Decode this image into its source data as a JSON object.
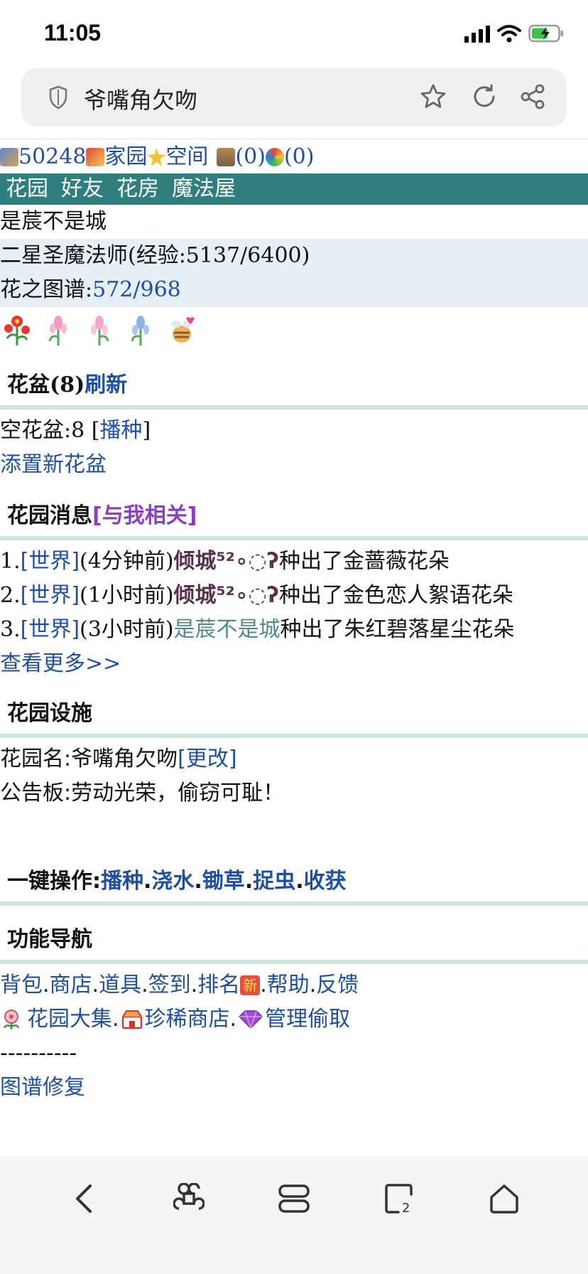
{
  "status_bar": {
    "time": "11:05"
  },
  "url_bar": {
    "title": "爷嘴角欠吻"
  },
  "top_line": {
    "coins": "50248",
    "home": "家园",
    "space": "空间",
    "count1": "(0)",
    "count2": "(0)"
  },
  "nav": {
    "items": [
      "花园",
      "好友",
      "花房",
      "魔法屋"
    ]
  },
  "profile": {
    "name": "是莀不是城",
    "rank_text": "二星圣魔法师(经验:5137/6400)",
    "atlas_label": "花之图谱:",
    "atlas_value": "572/968"
  },
  "pots": {
    "title": "花盆(8)",
    "refresh": "刷新",
    "empty_label": "空花盆:8 [",
    "sow": "播种",
    "empty_close": "]",
    "add": "添置新花盆"
  },
  "messages": {
    "title": "花园消息",
    "filter": "[与我相关]",
    "items": [
      {
        "num": "1.",
        "tag": "[世界]",
        "time": "(4分钟前)",
        "user": "倾城⁵²∘◌ʔ",
        "text": " 种出了金蔷薇花朵"
      },
      {
        "num": "2.",
        "tag": "[世界]",
        "time": "(1小时前)",
        "user": "倾城⁵²∘◌ʔ",
        "text": " 种出了金色恋人絮语花朵"
      },
      {
        "num": "3.",
        "tag": "[世界]",
        "time": "(3小时前)",
        "user": "是莀不是城",
        "text": "种出了朱红碧落星尘花朵"
      }
    ],
    "more": "查看更多>>"
  },
  "facilities": {
    "title": "花园设施",
    "name_label": "花园名:爷嘴角欠吻 ",
    "edit": "[更改]",
    "board": "公告板:劳动光荣，偷窃可耻！"
  },
  "one_key": {
    "label": "一键操作:",
    "actions": [
      "播种",
      "浇水",
      "锄草",
      "捉虫",
      "收获"
    ]
  },
  "function_nav": {
    "title": "功能导航",
    "row1": [
      "背包",
      "商店",
      "道具",
      "签到",
      "排名"
    ],
    "new_badge": "新",
    "row1b": [
      "帮助",
      "反馈"
    ],
    "row2": [
      "花园大集",
      "珍稀商店",
      "管理偷取"
    ],
    "divider": "----------",
    "repair": "图谱修复"
  },
  "colors": {
    "accent": "#2f7f7f",
    "link": "#1f4fa0",
    "band": "#e6eef6",
    "section_line": "#cde5dc"
  },
  "icons": [
    "shield-icon",
    "star-icon",
    "reload-icon",
    "share-icon",
    "back-icon",
    "command-icon",
    "tabs-icon",
    "tab-count-icon",
    "home-icon"
  ]
}
